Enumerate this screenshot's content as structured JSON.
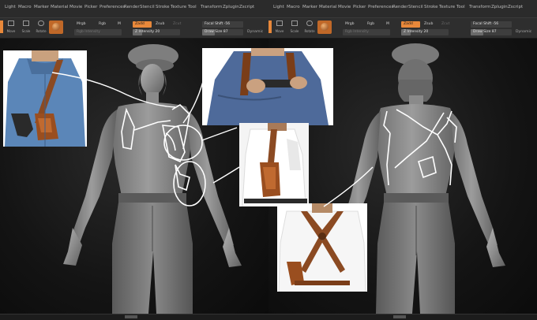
{
  "menu_items": [
    "Light",
    "Macro",
    "Marker",
    "Material",
    "Movie",
    "Picker",
    "Preferences",
    "Render",
    "Stencil",
    "Stroke",
    "Texture",
    "Tool",
    "Transform",
    "Zplugin",
    "Zscript"
  ],
  "tools": [
    {
      "label": "Move",
      "icon": "move-icon"
    },
    {
      "label": "Scale",
      "icon": "scale-icon"
    },
    {
      "label": "Rotate",
      "icon": "rotate-icon"
    }
  ],
  "toolbar": {
    "mrgb": "Mrgb",
    "rgb": "Rgb",
    "m": "M",
    "zadd": "Zadd",
    "zsub": "Zsub",
    "zcut": "Zcut",
    "rgb_intensity": "Rgb Intensity",
    "z_intensity": "Z Intensity 20",
    "focal_shift": "Focal Shift -56",
    "draw_size": "Draw Size 87",
    "dynamic": "Dynamic"
  },
  "colors": {
    "accent": "#e8883a",
    "menubar": "#2b2b2b",
    "toolbar": "#2e2e2e",
    "sculpt": "#9a9a9a",
    "line_art": "#ffffff"
  },
  "reference_images": [
    {
      "subject": "man in denim shirt wearing brown shoulder holster"
    },
    {
      "subject": "man in blue shirt drawing pistol from shoulder rig"
    },
    {
      "subject": "side view of man in white shirt with leather holster"
    },
    {
      "subject": "back view of shoulder holster straps on white shirt"
    }
  ]
}
